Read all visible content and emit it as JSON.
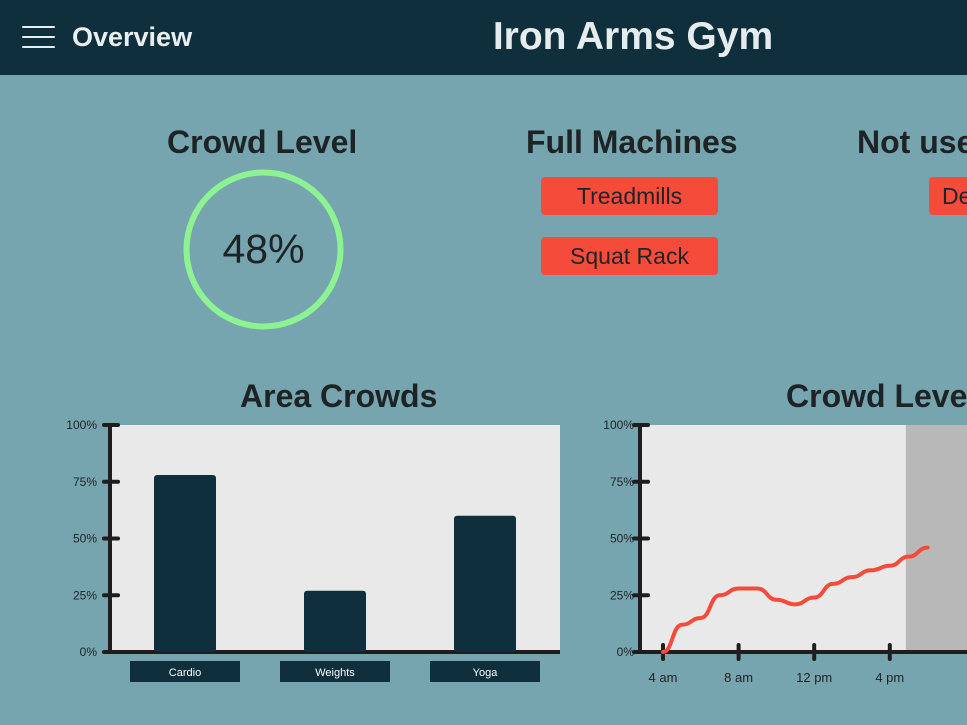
{
  "header": {
    "menu_icon": "hamburger-menu-icon",
    "nav_label": "Overview",
    "title": "Iron Arms Gym"
  },
  "crowd_level": {
    "heading": "Crowd Level",
    "percent": 48,
    "label": "48%",
    "ring_color": "#8df392"
  },
  "full_machines": {
    "heading": "Full Machines",
    "items": [
      "Treadmills",
      "Squat Rack"
    ]
  },
  "not_used": {
    "heading": "Not use",
    "items": [
      "De"
    ]
  },
  "colors": {
    "header_bg": "#0e2f3b",
    "page_bg": "#76a4af",
    "chip": "#f44b3b",
    "bar": "#0e2f3b",
    "line": "#f44b3b",
    "plot_bg": "#e9e9e9",
    "future_shade": "#b8b8b8"
  },
  "chart_data": [
    {
      "type": "bar",
      "title": "Area Crowds",
      "categories": [
        "Cardio",
        "Weights",
        "Yoga"
      ],
      "values": [
        78,
        27,
        60
      ],
      "ylim": [
        0,
        100
      ],
      "yticks": [
        "0%",
        "25%",
        "50%",
        "75%",
        "100%"
      ],
      "grid": false
    },
    {
      "type": "line",
      "title": "Crowd Level",
      "x": [
        "4 am",
        "5 am",
        "6 am",
        "7 am",
        "8 am",
        "9 am",
        "10 am",
        "11 am",
        "12 pm",
        "1 pm",
        "2 pm",
        "3 pm",
        "4 pm",
        "5 pm",
        "6 pm"
      ],
      "values": [
        0,
        12,
        15,
        25,
        28,
        28,
        23,
        21,
        24,
        30,
        33,
        36,
        38,
        42,
        46
      ],
      "xticks": [
        "4 am",
        "8 am",
        "12 pm",
        "4 pm"
      ],
      "ylim": [
        0,
        100
      ],
      "yticks": [
        "0%",
        "25%",
        "50%",
        "75%",
        "100%"
      ],
      "shaded_from": "4 pm",
      "grid": false
    }
  ]
}
